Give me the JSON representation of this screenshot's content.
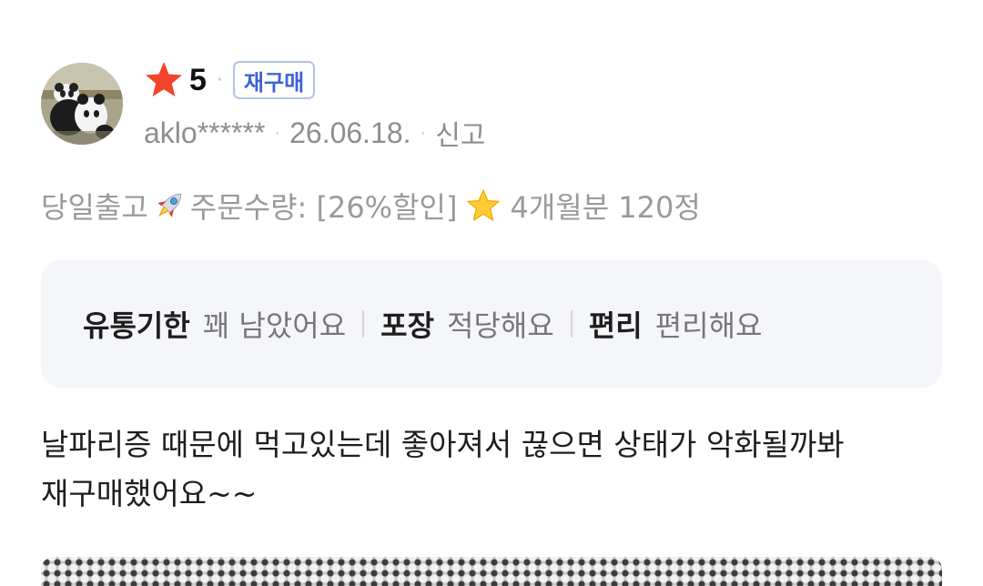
{
  "review": {
    "rating": "5",
    "badge": "재구매",
    "user": "aklo******",
    "date": "26.06.18.",
    "report": "신고",
    "option": {
      "part1": "당일출고",
      "part2": "주문수량: [26%할인]",
      "part3": "4개월분 120정"
    },
    "evaluations": [
      {
        "key": "유통기한",
        "value": "꽤 남았어요"
      },
      {
        "key": "포장",
        "value": "적당해요"
      },
      {
        "key": "편리",
        "value": "편리해요"
      }
    ],
    "body_line1": "날파리증 때문에 먹고있는데 좋아져서 끊으면 상태가 악화될까봐",
    "body_line2": "재구매했어요~~"
  },
  "colors": {
    "star": "#f2432b",
    "badge_text": "#3e63d6",
    "badge_border": "#b7c3e6",
    "meta_text": "#8e8e8e",
    "eval_bg": "#f5f6fa"
  },
  "icons": [
    "user-avatar-panda",
    "star-icon",
    "rocket-icon",
    "star-emoji-icon"
  ]
}
